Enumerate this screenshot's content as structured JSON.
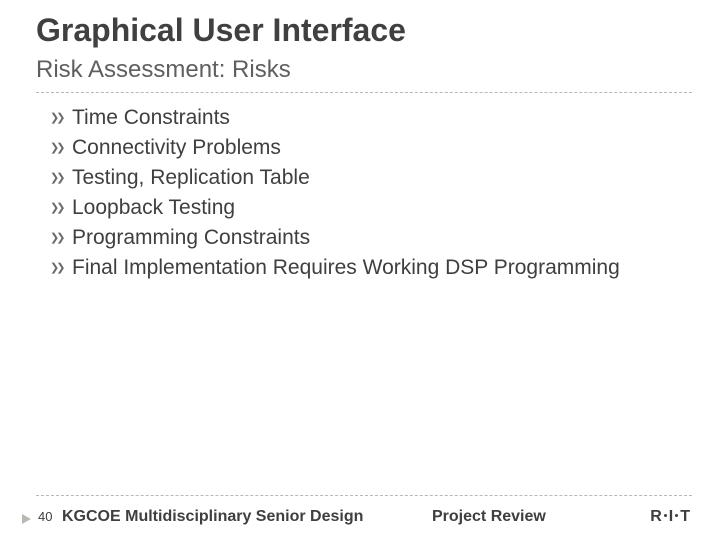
{
  "title": "Graphical User Interface",
  "subtitle": "Risk Assessment: Risks",
  "bullets": [
    "Time Constraints",
    "Connectivity Problems",
    "Testing, Replication Table",
    "Loopback Testing",
    "Programming Constraints",
    "Final Implementation Requires Working DSP Programming"
  ],
  "footer": {
    "page_number": "40",
    "left": "KGCOE Multidisciplinary Senior Design",
    "center": "Project Review",
    "right_r": "R",
    "right_i": "I",
    "right_t": "T"
  }
}
